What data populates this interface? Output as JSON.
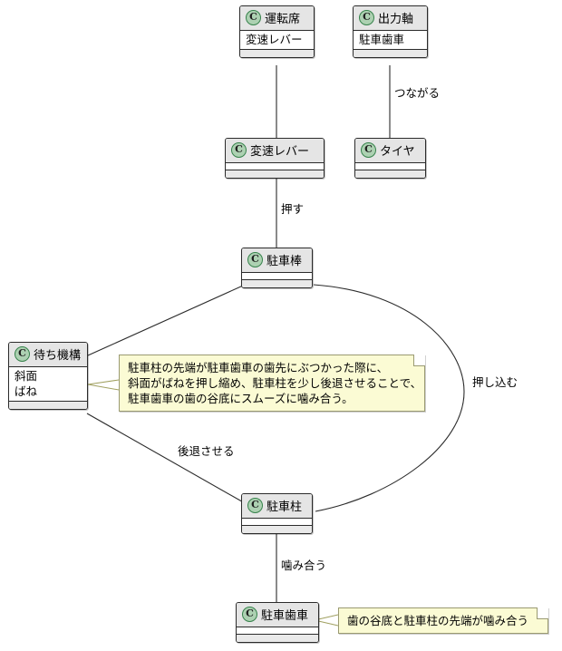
{
  "diagram": {
    "type": "uml-class-diagram",
    "title": "",
    "background": "#ffffff",
    "class_header_color": "#e5e5e5",
    "class_badge_color": "#add1b2",
    "class_badge_border": "#36824b",
    "note_color": "#fbfbd4",
    "note_border": "#9a9a72",
    "line_color": "#2b2b2b",
    "badge_letter": "C"
  },
  "classes": [
    {
      "id": "untensheki",
      "name": "運転席",
      "attributes": [
        "変速レバー"
      ],
      "methods": []
    },
    {
      "id": "shutsuryokujiku",
      "name": "出力軸",
      "attributes": [
        "駐車歯車"
      ],
      "methods": []
    },
    {
      "id": "hensoku-lever",
      "name": "変速レバー",
      "attributes": [],
      "methods": []
    },
    {
      "id": "tire",
      "name": "タイヤ",
      "attributes": [],
      "methods": []
    },
    {
      "id": "chushabou",
      "name": "駐車棒",
      "attributes": [],
      "methods": []
    },
    {
      "id": "machikikou",
      "name": "待ち機構",
      "attributes": [
        "斜面",
        "ばね"
      ],
      "methods": []
    },
    {
      "id": "chushachu",
      "name": "駐車柱",
      "attributes": [],
      "methods": []
    },
    {
      "id": "chushahaguruma",
      "name": "駐車歯車",
      "attributes": [],
      "methods": []
    }
  ],
  "edges": [
    {
      "id": "e1",
      "from": "untensheki",
      "to": "hensoku-lever",
      "label": ""
    },
    {
      "id": "e2",
      "from": "shutsuryokujiku",
      "to": "tire",
      "label": "つながる"
    },
    {
      "id": "e3",
      "from": "hensoku-lever",
      "to": "chushabou",
      "label": "押す"
    },
    {
      "id": "e4",
      "from": "chushabou",
      "to": "chushachu",
      "label": "押し込む"
    },
    {
      "id": "e5",
      "from": "chushabou",
      "to": "machikikou",
      "label": ""
    },
    {
      "id": "e6",
      "from": "machikikou",
      "to": "chushachu",
      "label": "後退させる"
    },
    {
      "id": "e7",
      "from": "chushachu",
      "to": "chushahaguruma",
      "label": "噛み合う"
    }
  ],
  "notes": [
    {
      "id": "note-machikikou",
      "attached_to": "machikikou",
      "lines": [
        "駐車柱の先端が駐車歯車の歯先にぶつかった際に、",
        "斜面がばねを押し縮め、駐車柱を少し後退させることで、",
        "駐車歯車の歯の谷底にスムーズに噛み合う。"
      ]
    },
    {
      "id": "note-haguruma",
      "attached_to": "chushahaguruma",
      "lines": [
        "歯の谷底と駐車柱の先端が噛み合う"
      ]
    }
  ]
}
